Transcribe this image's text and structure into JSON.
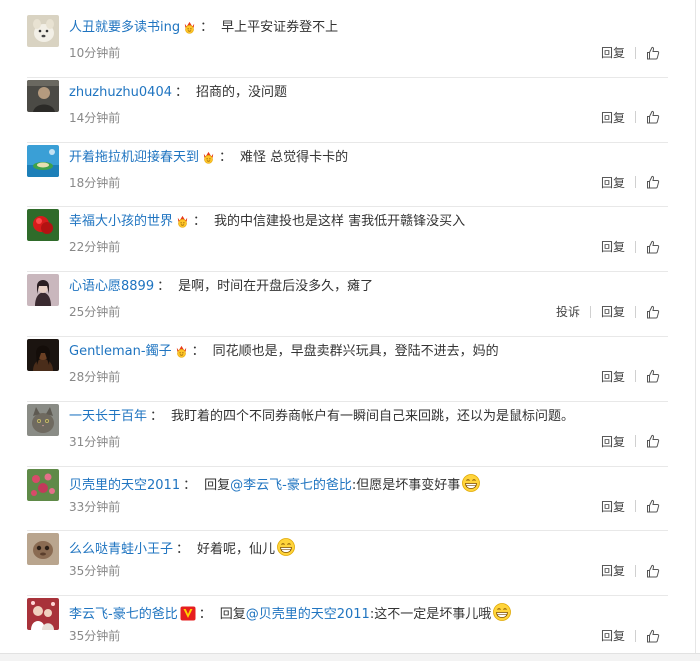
{
  "colors": {
    "username": "#1f74c0",
    "text": "#333333",
    "time": "#888888",
    "divider": "#e8e8e8"
  },
  "icons": {
    "like": "thumbs-up-icon",
    "crown_badge": "crown-emoji-badge-icon",
    "v_badge": "verified-v-badge-icon",
    "grin": "grin-emoji-icon"
  },
  "comments": [
    {
      "user": "人丑就要多读书ing",
      "text": "早上平安证券登不上",
      "time": "10分钟前",
      "reply": "回复"
    },
    {
      "user": "zhuzhuzhu0404",
      "text": "招商的，没问题",
      "time": "14分钟前",
      "reply": "回复"
    },
    {
      "user": "开着拖拉机迎接春天到",
      "text": "难怪 总觉得卡卡的",
      "time": "18分钟前",
      "reply": "回复"
    },
    {
      "user": "幸福大小孩的世界",
      "text": "我的中信建投也是这样 害我低开赣锋没买入",
      "time": "22分钟前",
      "reply": "回复"
    },
    {
      "user": "心语心愿8899",
      "text": "是啊，时间在开盘后没多久，瘫了",
      "time": "25分钟前",
      "report": "投诉",
      "reply": "回复"
    },
    {
      "user": "Gentleman-鐲子",
      "text": "同花顺也是，早盘卖群兴玩具，登陆不进去，妈的",
      "time": "28分钟前",
      "reply": "回复"
    },
    {
      "user": "一天长于百年",
      "text": "我盯着的四个不同券商帐户有一瞬间自己来回跳，还以为是鼠标问题。",
      "time": "31分钟前",
      "reply": "回复"
    },
    {
      "user": "贝壳里的天空2011",
      "reply_prefix": "回复",
      "mention": "@李云飞-豪七的爸比",
      "text": ":但愿是坏事变好事",
      "time": "33分钟前",
      "reply": "回复"
    },
    {
      "user": "么么哒青蛙小王子",
      "text": "好着呢，仙儿",
      "time": "35分钟前",
      "reply": "回复"
    },
    {
      "user": "李云飞-豪七的爸比",
      "reply_prefix": "回复",
      "mention": "@贝壳里的天空2011",
      "text": ":这不一定是坏事儿哦",
      "time": "35分钟前",
      "reply": "回复"
    }
  ]
}
